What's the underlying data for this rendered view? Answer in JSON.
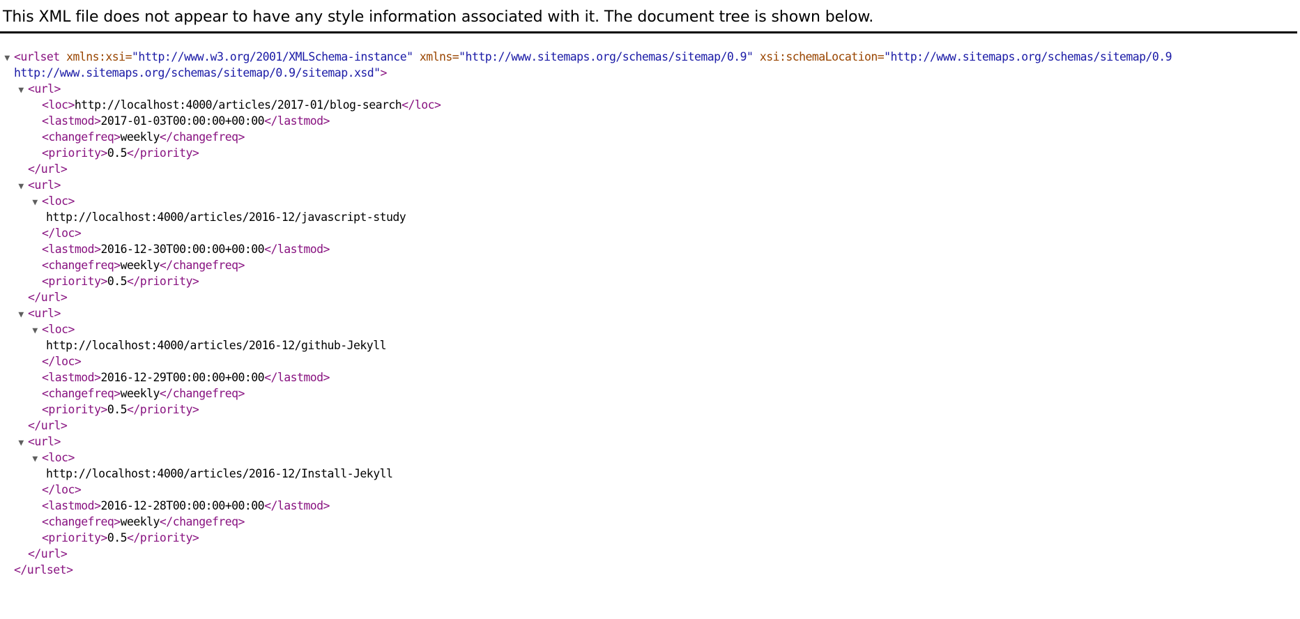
{
  "header": {
    "message": "This XML file does not appear to have any style information associated with it. The document tree is shown below."
  },
  "root": {
    "tag": "urlset",
    "attr_line1": [
      {
        "name": "xmlns:xsi",
        "value": "\"http://www.w3.org/2001/XMLSchema-instance\""
      },
      {
        "name": "xmlns",
        "value": "\"http://www.sitemaps.org/schemas/sitemap/0.9\""
      },
      {
        "name": "xsi:schemaLocation",
        "value": "\"http://www.sitemaps.org/schemas/sitemap/0.9"
      }
    ],
    "attr_line2": "http://www.sitemaps.org/schemas/sitemap/0.9/sitemap.xsd\"",
    "close": "</urlset>"
  },
  "urls": [
    {
      "loc": "http://localhost:4000/articles/2017-01/blog-search",
      "lastmod": "2017-01-03T00:00:00+00:00",
      "changefreq": "weekly",
      "priority": "0.5",
      "loc_inline": true
    },
    {
      "loc": "http://localhost:4000/articles/2016-12/javascript-study",
      "lastmod": "2016-12-30T00:00:00+00:00",
      "changefreq": "weekly",
      "priority": "0.5",
      "loc_inline": false
    },
    {
      "loc": "http://localhost:4000/articles/2016-12/github-Jekyll",
      "lastmod": "2016-12-29T00:00:00+00:00",
      "changefreq": "weekly",
      "priority": "0.5",
      "loc_inline": false
    },
    {
      "loc": "http://localhost:4000/articles/2016-12/Install-Jekyll",
      "lastmod": "2016-12-28T00:00:00+00:00",
      "changefreq": "weekly",
      "priority": "0.5",
      "loc_inline": false
    }
  ],
  "tags": {
    "url_open": "<url>",
    "url_close": "</url>",
    "loc_open": "<loc>",
    "loc_close": "</loc>",
    "lastmod_open": "<lastmod>",
    "lastmod_close": "</lastmod>",
    "changefreq_open": "<changefreq>",
    "changefreq_close": "</changefreq>",
    "priority_open": "<priority>",
    "priority_close": "</priority>"
  },
  "icons": {
    "toggle": "▼"
  },
  "colors": {
    "tag": "#881280",
    "attr_name": "#994500",
    "attr_value": "#1a1aa6",
    "toggle": "#5e5e5e"
  }
}
